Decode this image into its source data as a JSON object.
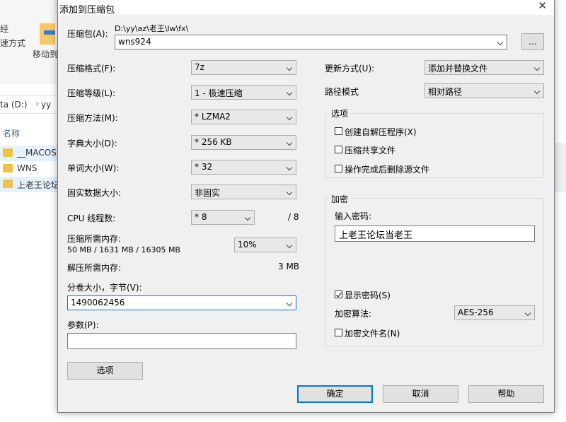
{
  "explorer": {
    "ribbon_text_1": "经",
    "ribbon_text_2": "速方式",
    "move_label": "移动到",
    "address_drive": "ta (D:)",
    "address_folder": "yy",
    "column_name": "名称",
    "rows": [
      {
        "name": "__MACOS"
      },
      {
        "name": "WNS"
      },
      {
        "name": "上老王论坛"
      }
    ]
  },
  "dialog": {
    "title": "添加到压缩包",
    "close_glyph": "✕",
    "archive": {
      "label": "压缩包(A):",
      "path": "D:\\yy\\az\\老王\\lw\\fx\\",
      "name": "wns924",
      "browse_label": "..."
    },
    "left": {
      "format_label": "压缩格式(F):",
      "format_value": "7z",
      "level_label": "压缩等级(L):",
      "level_value": "1 - 极速压缩",
      "method_label": "压缩方法(M):",
      "method_value": "* LZMA2",
      "dict_label": "字典大小(D):",
      "dict_value": "* 256 KB",
      "word_label": "单词大小(W):",
      "word_value": "* 32",
      "solid_label": "固实数据大小:",
      "solid_value": "非固实",
      "threads_label": "CPU 线程数:",
      "threads_value": "* 8",
      "threads_total": "/ 8",
      "mem_comp_label": "压缩所需内存:",
      "mem_comp_detail": "50 MB / 1631 MB / 16305 MB",
      "mem_comp_value": "10%",
      "mem_decomp_label": "解压所需内存:",
      "mem_decomp_value": "3 MB",
      "split_label": "分卷大小，字节(V):",
      "split_value": "1490062456",
      "params_label": "参数(P):",
      "params_value": "",
      "options_button": "选项"
    },
    "right": {
      "update_label": "更新方式(U):",
      "update_value": "添加并替换文件",
      "pathmode_label": "路径模式",
      "pathmode_value": "相对路径",
      "options_group": "选项",
      "opt_sfx": "创建自解压程序(X)",
      "opt_shared": "压缩共享文件",
      "opt_delete": "操作完成后删除源文件",
      "encryption_group": "加密",
      "password_label": "输入密码:",
      "password_value": "上老王论坛当老王",
      "show_password": "显示密码(S)",
      "method_label": "加密算法:",
      "method_value": "AES-256",
      "encrypt_names": "加密文件名(N)"
    },
    "buttons": {
      "ok": "确定",
      "cancel": "取消",
      "help": "帮助"
    }
  }
}
